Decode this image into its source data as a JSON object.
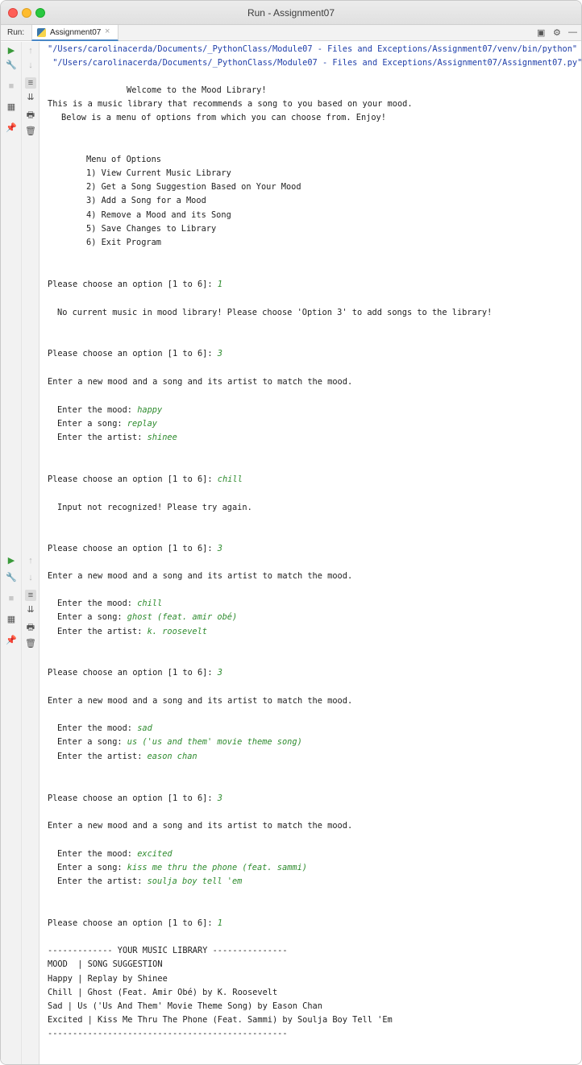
{
  "window": {
    "title": "Run - Assignment07"
  },
  "toolbar": {
    "run_label": "Run:",
    "tab_label": "Assignment07",
    "tab_close": "×"
  },
  "console": {
    "path_python": "\"/Users/carolinacerda/Documents/_PythonClass/Module07 - Files and Exceptions/Assignment07/venv/bin/python\"",
    "path_script": " \"/Users/carolinacerda/Documents/_PythonClass/Module07 - Files and Exceptions/Assignment07/Assignment07.py\"",
    "welcome": "Welcome to the Mood Library!",
    "intro_1": "This is a music library that recommends a song to you based on your mood.",
    "intro_2": "Below is a menu of options from which you can choose from. Enjoy!",
    "menu_title": "Menu of Options",
    "menu_items": [
      "1) View Current Music Library",
      "2) Get a Song Suggestion Based on Your Mood",
      "3) Add a Song for a Mood",
      "4) Remove a Mood and its Song",
      "5) Save Changes to Library",
      "6) Exit Program"
    ],
    "prompt": "Please choose an option [1 to 6]: ",
    "prompt_inputs": [
      "1",
      "3",
      "chill",
      "3",
      "3",
      "3",
      "1"
    ],
    "no_music_msg": "No current music in mood library! Please choose 'Option 3' to add songs to the library!",
    "enter_new_mood_msg": "Enter a new mood and a song and its artist to match the mood.",
    "label_mood": "Enter the mood: ",
    "label_song": "Enter a song: ",
    "label_artist": "Enter the artist: ",
    "not_recognized_msg": "Input not recognized! Please try again.",
    "entries": [
      {
        "mood": "happy",
        "song": "replay",
        "artist": "shinee"
      },
      {
        "mood": "chill",
        "song": "ghost (feat. amir obé)",
        "artist": "k. roosevelt"
      },
      {
        "mood": "sad",
        "song": "us ('us and them' movie theme song)",
        "artist": "eason chan"
      },
      {
        "mood": "excited",
        "song": "kiss me thru the phone (feat. sammi)",
        "artist": "soulja boy tell 'em"
      }
    ],
    "library_header": "------------- YOUR MUSIC LIBRARY ---------------",
    "library_columns": "MOOD  | SONG SUGGESTION",
    "library_rows": [
      "Happy | Replay by Shinee",
      "Chill | Ghost (Feat. Amir Obé) by K. Roosevelt",
      "Sad | Us ('Us And Them' Movie Theme Song) by Eason Chan",
      "Excited | Kiss Me Thru The Phone (Feat. Sammi) by Soulja Boy Tell 'Em"
    ],
    "library_footer": "------------------------------------------------"
  }
}
